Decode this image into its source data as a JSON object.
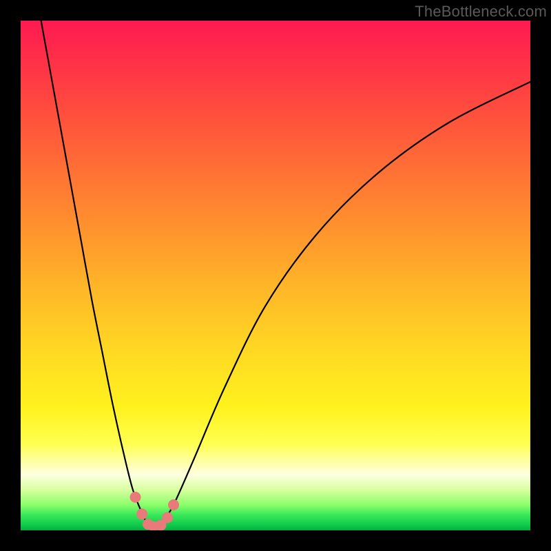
{
  "watermark": "TheBottleneck.com",
  "chart_data": {
    "type": "line",
    "title": "",
    "xlabel": "",
    "ylabel": "",
    "xlim": [
      0,
      100
    ],
    "ylim": [
      0,
      100
    ],
    "grid": false,
    "legend": false,
    "series": [
      {
        "name": "bottleneck-curve",
        "x": [
          4,
          6,
          8,
          10,
          12,
          14,
          16,
          18,
          20,
          22,
          24,
          25,
          26,
          27,
          28,
          30,
          34,
          40,
          48,
          58,
          70,
          84,
          100
        ],
        "values": [
          100,
          89,
          78,
          67,
          56,
          45,
          35,
          25,
          16,
          8,
          3,
          1,
          0.5,
          1,
          2,
          5,
          14,
          28,
          44,
          58,
          70,
          80,
          88
        ]
      }
    ],
    "markers": {
      "name": "highlight-dots",
      "color": "#e87a7a",
      "x": [
        22.5,
        23.8,
        25.0,
        26.2,
        27.5,
        28.8,
        30.0
      ],
      "values": [
        6.5,
        3.2,
        1.2,
        0.7,
        1.0,
        2.5,
        5.0
      ]
    },
    "notes": "Values are visual estimates on 0–100 axes; background gradient runs red (top, high bottleneck) → yellow → green (bottom, optimal match)."
  }
}
